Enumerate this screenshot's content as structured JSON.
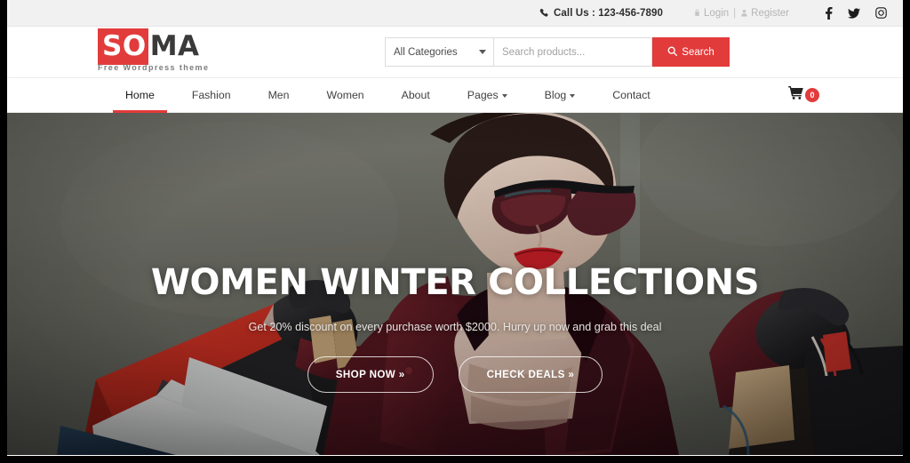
{
  "topbar": {
    "phone_icon": "phone-icon",
    "call_label": "Call Us : 123-456-7890",
    "login_label": "Login",
    "separator": "|",
    "register_label": "Register",
    "socials": [
      {
        "name": "facebook-icon",
        "label": "Facebook"
      },
      {
        "name": "twitter-icon",
        "label": "Twitter"
      },
      {
        "name": "instagram-icon",
        "label": "Instagram"
      }
    ]
  },
  "header": {
    "logo": {
      "part_highlight": "SO",
      "part_plain": "MA",
      "tagline": "Free Wordpress theme"
    },
    "search": {
      "category_value": "All Categories",
      "category_options": [
        "All Categories"
      ],
      "placeholder": "Search products...",
      "input_value": "",
      "button_label": "Search",
      "button_icon": "search-icon"
    }
  },
  "nav": {
    "items": [
      {
        "label": "Home",
        "active": true,
        "dropdown": false
      },
      {
        "label": "Fashion",
        "active": false,
        "dropdown": false
      },
      {
        "label": "Men",
        "active": false,
        "dropdown": false
      },
      {
        "label": "Women",
        "active": false,
        "dropdown": false
      },
      {
        "label": "About",
        "active": false,
        "dropdown": false
      },
      {
        "label": "Pages",
        "active": false,
        "dropdown": true
      },
      {
        "label": "Blog",
        "active": false,
        "dropdown": true
      },
      {
        "label": "Contact",
        "active": false,
        "dropdown": false
      }
    ],
    "cart": {
      "icon": "shopping-cart-icon",
      "count": "0"
    }
  },
  "hero": {
    "title": "WOMEN WINTER COLLECTIONS",
    "subtitle": "Get 20% discount on every purchase worth $2000. Hurry up now and grab this deal",
    "primary_button": "SHOP NOW »",
    "secondary_button": "CHECK DEALS »"
  },
  "colors": {
    "accent_red": "#e23b3b",
    "topbar_bg": "#f1f1f1",
    "nav_text": "#414141",
    "page_bg": "#ffffff",
    "frame": "#000000"
  }
}
